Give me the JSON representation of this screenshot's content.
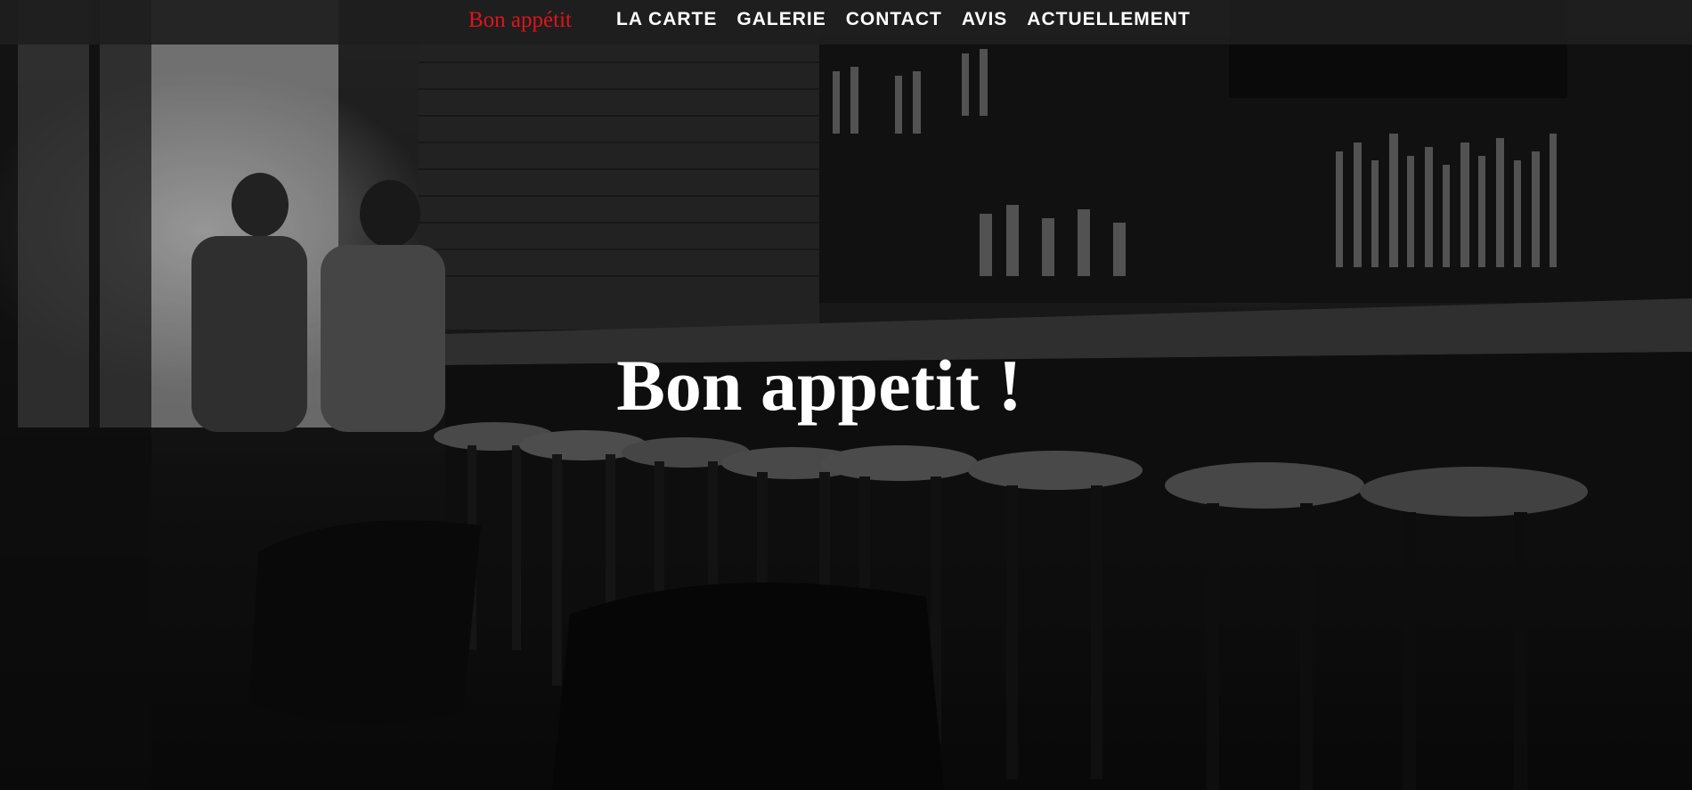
{
  "nav": {
    "brand": "Bon appétit",
    "links": [
      "LA CARTE",
      "GALERIE",
      "CONTACT",
      "AVIS",
      "ACTUELLEMENT"
    ]
  },
  "hero": {
    "title": "Bon appetit !"
  },
  "colors": {
    "brand": "#e0141b",
    "nav_bg": "#1e1e1e",
    "text": "#ffffff"
  }
}
